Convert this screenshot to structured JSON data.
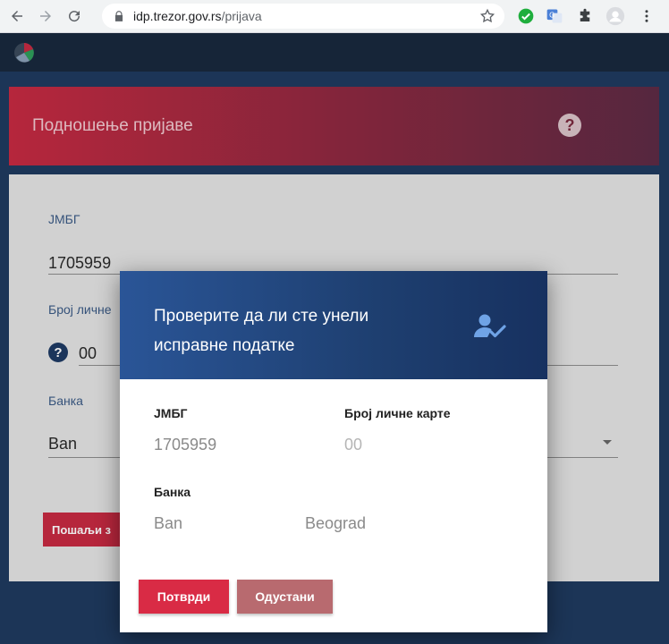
{
  "browser": {
    "url_host": "idp.trezor.gov.rs",
    "url_path": "/prijava"
  },
  "banner": {
    "title": "Подношење пријаве",
    "help_glyph": "?"
  },
  "form": {
    "jmbg_label": "ЈМБГ",
    "jmbg_value": "1705959",
    "id_card_label": "Број личне",
    "id_card_value": "00",
    "bank_label": "Банка",
    "bank_value": "Ban",
    "submit_label": "Пошаљи з"
  },
  "modal": {
    "title_line1": "Проверите да ли сте унели",
    "title_line2": "исправне податке",
    "jmbg_label": "ЈМБГ",
    "jmbg_value": "1705959",
    "id_card_label": "Број личне карте",
    "id_card_value": "00",
    "bank_label": "Банка",
    "bank_value_part1": "Ban",
    "bank_value_part2": "Beograd",
    "confirm_label": "Потврди",
    "cancel_label": "Одустани"
  },
  "icons": {
    "back": "arrow-back-icon",
    "forward": "arrow-forward-icon",
    "reload": "reload-icon",
    "lock": "lock-icon",
    "star": "star-icon",
    "check_ext": "check-circle-icon",
    "translate_ext": "translate-icon",
    "puzzle_ext": "puzzle-icon",
    "profile": "avatar-icon",
    "menu": "kebab-menu-icon",
    "verified_user": "user-check-icon"
  },
  "colors": {
    "banner_red": "#c62a42",
    "modal_header_blue": "#2a5597",
    "confirm_red": "#d92b45",
    "cancel_muted": "#b86a6f"
  }
}
